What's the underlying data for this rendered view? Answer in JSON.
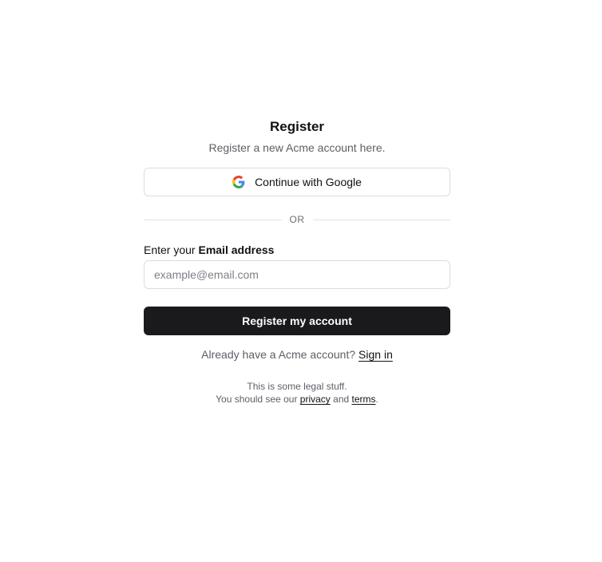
{
  "header": {
    "title": "Register",
    "subtitle": "Register a new Acme account here."
  },
  "google": {
    "label": "Continue with Google",
    "icon": "google-icon"
  },
  "divider": {
    "text": "OR"
  },
  "email": {
    "label_prefix": "Enter your ",
    "label_bold": "Email address",
    "placeholder": "example@email.com",
    "value": ""
  },
  "register": {
    "label": "Register my account"
  },
  "signin": {
    "prompt": "Already have a Acme account?",
    "link": "Sign in"
  },
  "legal": {
    "line1": "This is some legal stuff.",
    "line2_prefix": "You should see our ",
    "privacy": "privacy",
    "and": "and",
    "terms": "terms",
    "period": "."
  },
  "colors": {
    "primary_button": "#1a1a1c",
    "border": "#dcdde0",
    "muted_text": "#5c5f66"
  }
}
